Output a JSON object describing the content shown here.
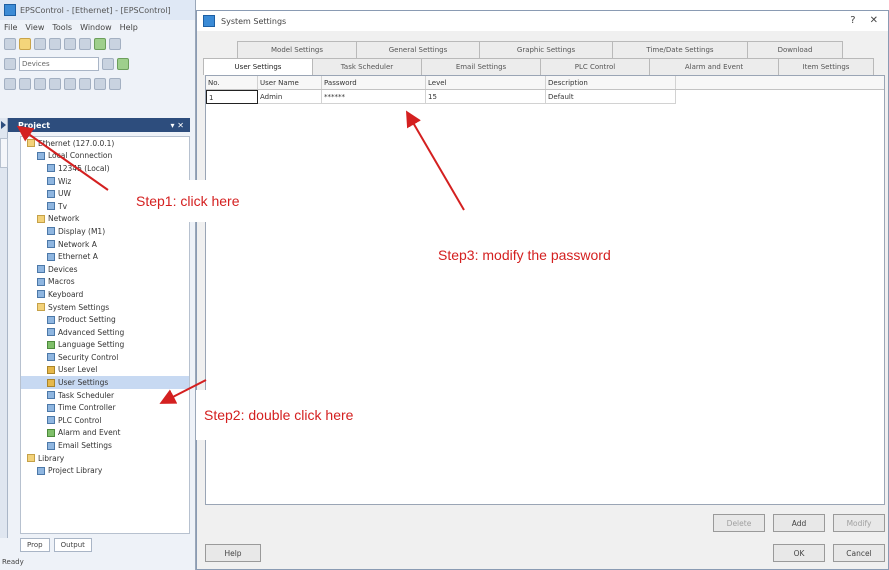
{
  "ide": {
    "title": "EPSControl - [Ethernet] - [EPSControl]",
    "menu": [
      "File",
      "View",
      "Tools",
      "Window",
      "Help"
    ],
    "device_combo": "Devices",
    "project_panel_title": "Project",
    "project_panel_controls": "▾ ✕",
    "tree": [
      {
        "label": "Ethernet (127.0.0.1)",
        "indent": 0,
        "icon": "folder"
      },
      {
        "label": "Local Connection",
        "indent": 1,
        "icon": "cfg"
      },
      {
        "label": "12345 (Local)",
        "indent": 2,
        "icon": "cfg"
      },
      {
        "label": "Wiz",
        "indent": 2,
        "icon": "cfg"
      },
      {
        "label": "UW",
        "indent": 2,
        "icon": "cfg"
      },
      {
        "label": "Tv",
        "indent": 2,
        "icon": "cfg"
      },
      {
        "label": "Network",
        "indent": 1,
        "icon": "folder"
      },
      {
        "label": "Display (M1)",
        "indent": 2,
        "icon": "cfg"
      },
      {
        "label": "Network A",
        "indent": 2,
        "icon": "cfg"
      },
      {
        "label": "Ethernet A",
        "indent": 2,
        "icon": "cfg"
      },
      {
        "label": "Devices",
        "indent": 1,
        "icon": "cfg"
      },
      {
        "label": "Macros",
        "indent": 1,
        "icon": "cfg"
      },
      {
        "label": "Keyboard",
        "indent": 1,
        "icon": "cfg"
      },
      {
        "label": "System Settings",
        "indent": 1,
        "icon": "folder"
      },
      {
        "label": "Product Setting",
        "indent": 2,
        "icon": "cfg"
      },
      {
        "label": "Advanced Setting",
        "indent": 2,
        "icon": "cfg"
      },
      {
        "label": "Language Setting",
        "indent": 2,
        "icon": "grn"
      },
      {
        "label": "Security Control",
        "indent": 2,
        "icon": "cfg"
      },
      {
        "label": "User Level",
        "indent": 2,
        "icon": "key"
      },
      {
        "label": "User Settings",
        "indent": 2,
        "icon": "key",
        "selected": true
      },
      {
        "label": "Task Scheduler",
        "indent": 2,
        "icon": "cfg"
      },
      {
        "label": "Time Controller",
        "indent": 2,
        "icon": "cfg"
      },
      {
        "label": "PLC Control",
        "indent": 2,
        "icon": "cfg"
      },
      {
        "label": "Alarm and Event",
        "indent": 2,
        "icon": "grn"
      },
      {
        "label": "Email Settings",
        "indent": 2,
        "icon": "cfg"
      },
      {
        "label": "Library",
        "indent": 0,
        "icon": "folder"
      },
      {
        "label": "Project Library",
        "indent": 1,
        "icon": "cfg"
      }
    ],
    "bottom_tabs": [
      "Prop",
      "Output"
    ],
    "status": "Ready"
  },
  "dialog": {
    "title": "System Settings",
    "controls": {
      "help": "?",
      "close": "✕"
    },
    "tabs_row1": [
      "Model Settings",
      "General Settings",
      "Graphic Settings",
      "Time/Date Settings",
      "Download"
    ],
    "tabs_row2": [
      "User Settings",
      "Task Scheduler",
      "Email Settings",
      "PLC Control",
      "Alarm and Event",
      "Item Settings"
    ],
    "active_tab": "User Settings",
    "table": {
      "columns": [
        "No.",
        "User Name",
        "Password",
        "Level",
        "Description"
      ],
      "rows": [
        [
          "1",
          "Admin",
          "******",
          "15",
          "Default"
        ]
      ]
    },
    "buttons": {
      "delete": "Delete",
      "add": "Add",
      "modify": "Modify",
      "help": "Help",
      "ok": "OK",
      "cancel": "Cancel"
    }
  },
  "annotations": {
    "step1": "Step1: click here",
    "step2": "Step2: double click here",
    "step3": "Step3: modify the password",
    "color": "#d42020"
  }
}
